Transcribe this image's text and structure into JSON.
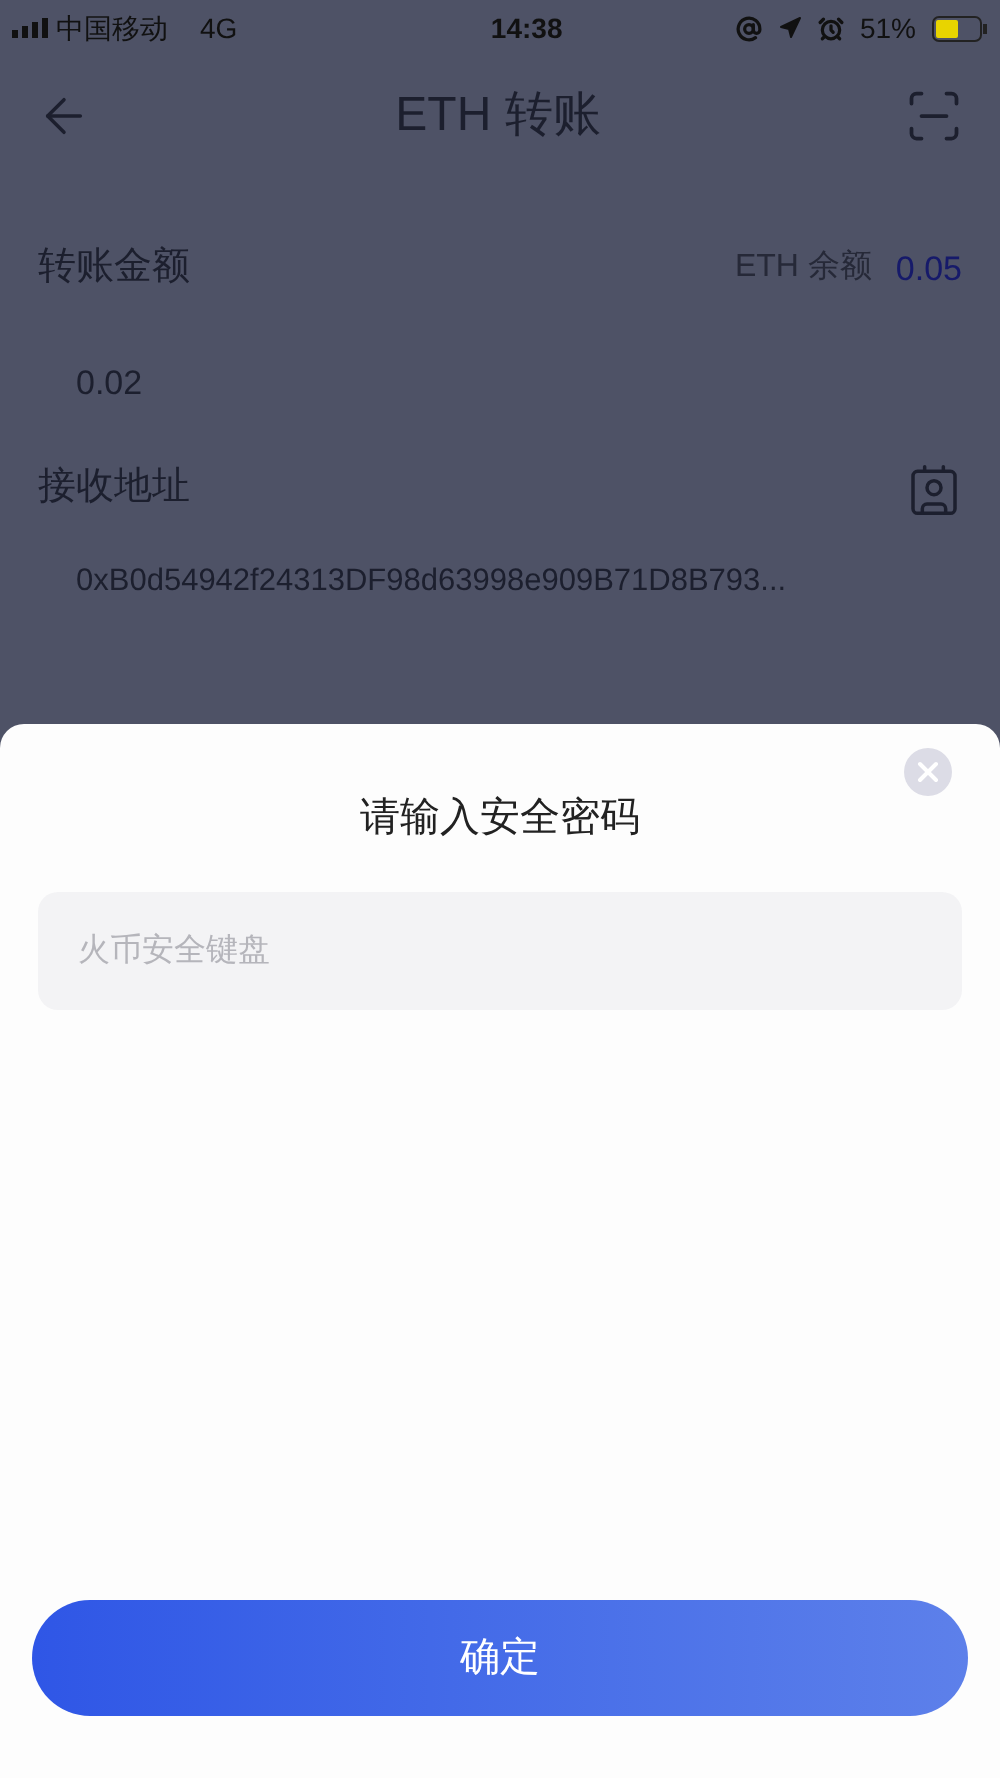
{
  "status_bar": {
    "carrier": "中国移动",
    "network": "4G",
    "time": "14:38",
    "battery": "51%"
  },
  "nav": {
    "title": "ETH 转账"
  },
  "amount": {
    "label": "转账金额",
    "balance_label": "ETH 余额",
    "balance": "0.05",
    "value": "0.02"
  },
  "address": {
    "label": "接收地址",
    "value": "0xB0d54942f24313DF98d63998e909B71D8B793..."
  },
  "dialog": {
    "title": "请输入安全密码",
    "password": {
      "placeholder": "火币安全键盘"
    },
    "confirm": "确定"
  }
}
